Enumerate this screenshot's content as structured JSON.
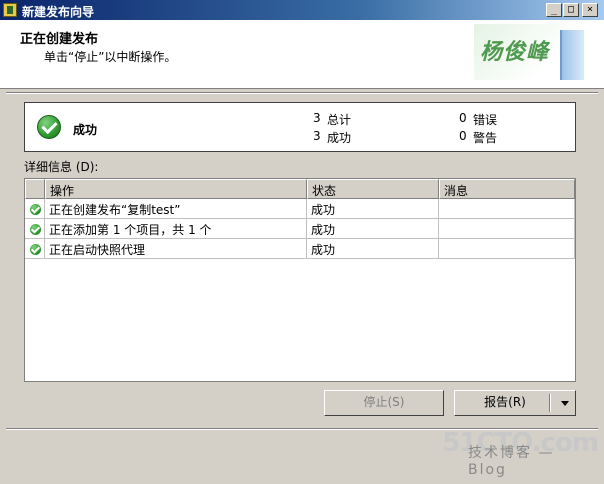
{
  "window": {
    "title": "新建发布向导",
    "min_glyph": "_",
    "max_glyph": "□",
    "close_glyph": "×"
  },
  "header": {
    "title": "正在创建发布",
    "subtitle": "单击“停止”以中断操作。",
    "logo_text": "杨俊峰"
  },
  "summary": {
    "status": "成功",
    "total_count": "3",
    "total_label": "总计",
    "success_count": "3",
    "success_label": "成功",
    "error_count": "0",
    "error_label": "错误",
    "warning_count": "0",
    "warning_label": "警告"
  },
  "details": {
    "label": "详细信息 (D):",
    "columns": [
      "操作",
      "状态",
      "消息"
    ],
    "rows": [
      {
        "action": "正在创建发布“复制test”",
        "status": "成功",
        "message": ""
      },
      {
        "action": "正在添加第 1 个项目，共 1 个",
        "status": "成功",
        "message": ""
      },
      {
        "action": "正在启动快照代理",
        "status": "成功",
        "message": ""
      }
    ]
  },
  "buttons": {
    "stop": "停止(S)",
    "report": "报告(R)"
  },
  "watermark": {
    "site": "51CTO.com",
    "tagline": "技术博客 — Blog"
  },
  "colors": {
    "titlebar_start": "#0a246a",
    "success_green": "#2f9a2f",
    "face": "#d4d0c8"
  }
}
